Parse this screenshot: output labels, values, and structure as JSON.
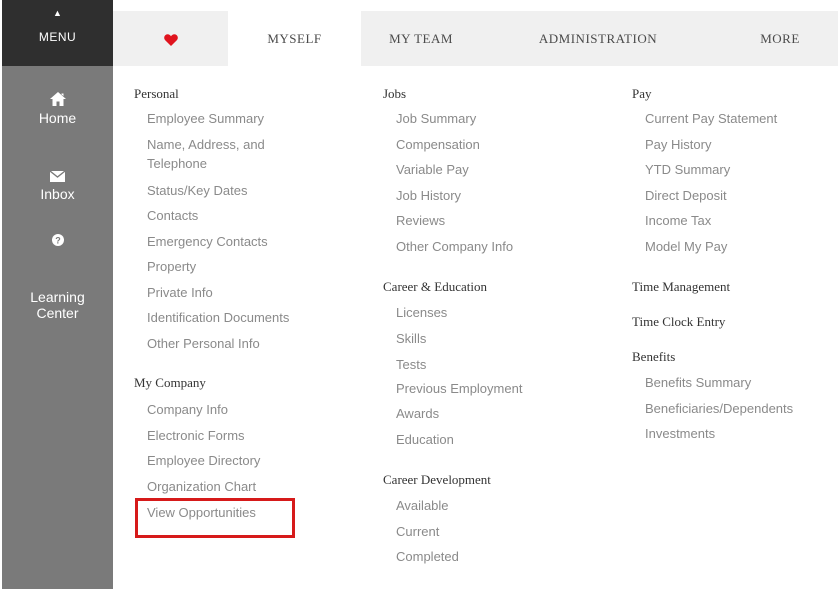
{
  "menu": {
    "label": "MENU"
  },
  "left_nav": [
    {
      "label": "Home",
      "icon": "home-icon"
    },
    {
      "label": "Inbox",
      "icon": "envelope-icon"
    },
    {
      "label": "Learning\nCenter",
      "icon": "question-icon"
    }
  ],
  "tabs": [
    {
      "label": "",
      "icon": "heart-icon"
    },
    {
      "label": "MYSELF",
      "active": true
    },
    {
      "label": "MY TEAM"
    },
    {
      "label": "ADMINISTRATION"
    },
    {
      "label": "MORE"
    }
  ],
  "columns": {
    "col1": {
      "personal_heading": "Personal",
      "personal": [
        "Employee Summary",
        "Name, Address, and",
        "Telephone",
        "Status/Key Dates",
        "Contacts",
        "Emergency Contacts",
        "Property",
        "Private Info",
        "Identification Documents",
        "Other Personal Info"
      ],
      "company_heading": "My Company",
      "company": [
        "Company Info",
        "Electronic Forms",
        "Employee Directory",
        "Organization Chart",
        "View Opportunities"
      ]
    },
    "col2": {
      "jobs_heading": "Jobs",
      "jobs": [
        "Job Summary",
        "Compensation",
        "Variable Pay",
        "Job History",
        "Reviews",
        "Other Company Info"
      ],
      "career_ed_heading": "Career & Education",
      "career_ed": [
        "Licenses",
        "Skills",
        "Tests",
        "Previous Employment",
        "Awards",
        "Education"
      ],
      "career_dev_heading": "Career Development",
      "career_dev": [
        "Available",
        "Current",
        "Completed"
      ]
    },
    "col3": {
      "pay_heading": "Pay",
      "pay": [
        "Current Pay Statement",
        "Pay History",
        "YTD Summary",
        "Direct Deposit",
        "Income Tax",
        "Model My Pay"
      ],
      "time_mgmt_heading": "Time Management",
      "time_clock_heading": "Time Clock Entry",
      "benefits_heading": "Benefits",
      "benefits": [
        "Benefits Summary",
        "Beneficiaries/Dependents",
        "Investments"
      ]
    }
  },
  "colors": {
    "highlight": "#d61a1a",
    "heart": "#e0141e",
    "nav_bg": "#7a7a7a",
    "menu_bg": "#2f2f2f"
  }
}
